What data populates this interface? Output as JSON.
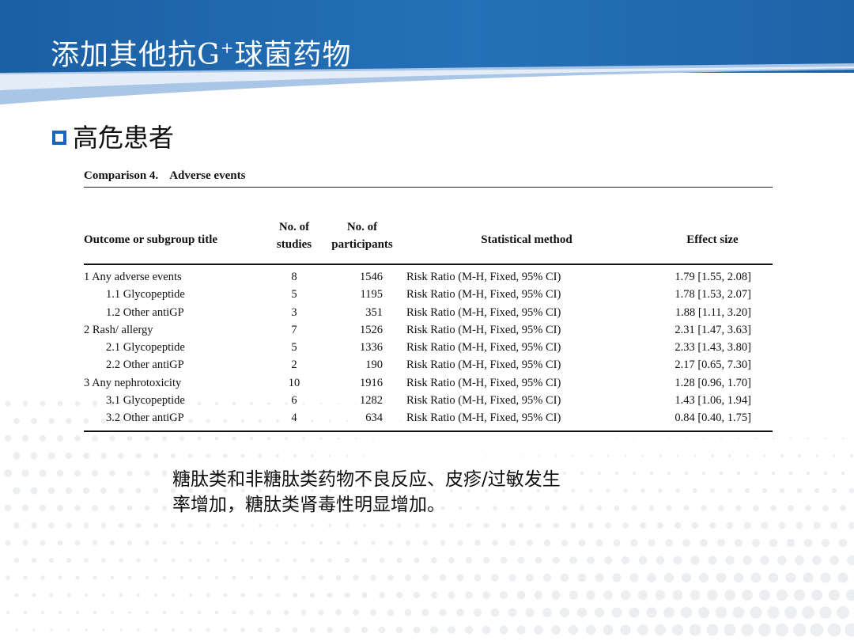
{
  "slide": {
    "title_main": "添加其他抗G",
    "title_sup": "+",
    "title_rest": "球菌药物",
    "section_heading": "高危患者",
    "note_line1": "糖肽类和非糖肽类药物不良反应、皮疹/过敏发生",
    "note_line2": "率增加，糖肽类肾毒性明显增加。"
  },
  "colors": {
    "header_blue": "#1b5fa3",
    "accent_blue": "#1b64b8"
  },
  "table": {
    "caption_num": "Comparison 4.",
    "caption_title": "Adverse events",
    "headers": {
      "outcome": "Outcome or subgroup title",
      "studies_1": "No. of",
      "studies_2": "studies",
      "participants_1": "No. of",
      "participants_2": "participants",
      "method": "Statistical method",
      "effect": "Effect size"
    },
    "rows": [
      {
        "outcome": "1 Any adverse events",
        "studies": "8",
        "participants": "1546",
        "method": "Risk Ratio (M-H, Fixed, 95% CI)",
        "effect": "1.79 [1.55, 2.08]"
      },
      {
        "outcome": "1.1 Glycopeptide",
        "studies": "5",
        "participants": "1195",
        "method": "Risk Ratio (M-H, Fixed, 95% CI)",
        "effect": "1.78 [1.53, 2.07]"
      },
      {
        "outcome": "1.2 Other antiGP",
        "studies": "3",
        "participants": "351",
        "method": "Risk Ratio (M-H, Fixed, 95% CI)",
        "effect": "1.88 [1.11, 3.20]"
      },
      {
        "outcome": "2 Rash/ allergy",
        "studies": "7",
        "participants": "1526",
        "method": "Risk Ratio (M-H, Fixed, 95% CI)",
        "effect": "2.31 [1.47, 3.63]"
      },
      {
        "outcome": "2.1 Glycopeptide",
        "studies": "5",
        "participants": "1336",
        "method": "Risk Ratio (M-H, Fixed, 95% CI)",
        "effect": "2.33 [1.43, 3.80]"
      },
      {
        "outcome": "2.2 Other antiGP",
        "studies": "2",
        "participants": "190",
        "method": "Risk Ratio (M-H, Fixed, 95% CI)",
        "effect": "2.17 [0.65, 7.30]"
      },
      {
        "outcome": "3 Any nephrotoxicity",
        "studies": "10",
        "participants": "1916",
        "method": "Risk Ratio (M-H, Fixed, 95% CI)",
        "effect": "1.28 [0.96, 1.70]"
      },
      {
        "outcome": "3.1 Glycopeptide",
        "studies": "6",
        "participants": "1282",
        "method": "Risk Ratio (M-H, Fixed, 95% CI)",
        "effect": "1.43 [1.06, 1.94]"
      },
      {
        "outcome": "3.2 Other antiGP",
        "studies": "4",
        "participants": "634",
        "method": "Risk Ratio (M-H, Fixed, 95% CI)",
        "effect": "0.84 [0.40, 1.75]"
      }
    ]
  }
}
